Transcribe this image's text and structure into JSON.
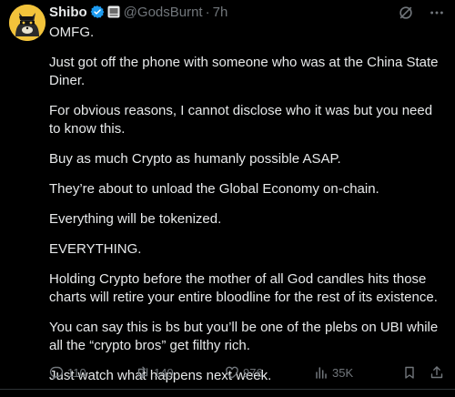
{
  "author": {
    "name": "Shibo",
    "handle": "@GodsBurnt",
    "separator": "·",
    "time": "7h"
  },
  "icons": {
    "verified": "verified-badge-icon",
    "affiliate": "affiliate-badge-icon",
    "grok": "grok-icon",
    "more": "more-icon",
    "reply": "reply-icon",
    "retweet": "retweet-icon",
    "like": "like-icon",
    "views": "views-icon",
    "bookmark": "bookmark-icon",
    "share": "share-icon"
  },
  "colors": {
    "background": "#000000",
    "text": "#e7e9ea",
    "muted": "#71767b",
    "verified": "#1d9bf0",
    "avatar_bg": "#f2c33b"
  },
  "paragraphs": [
    "OMFG.",
    "Just got off the phone with someone who was at the China State Diner.",
    "For obvious reasons, I cannot disclose who it was but you need to know this.",
    "Buy as much Crypto as humanly possible ASAP.",
    "They’re about to unload the Global Economy on-chain.",
    "Everything will be tokenized.",
    "EVERYTHING.",
    "Holding Crypto before the mother of all God candles hits those charts will retire your entire bloodline for the rest of its existence.",
    "You can say this is bs but you’ll be one of the plebs on UBI while all the “crypto bros” get filthy rich.",
    "Just watch what happens next week."
  ],
  "stats": {
    "replies": "110",
    "retweets": "149",
    "likes": "976",
    "views": "35K"
  }
}
